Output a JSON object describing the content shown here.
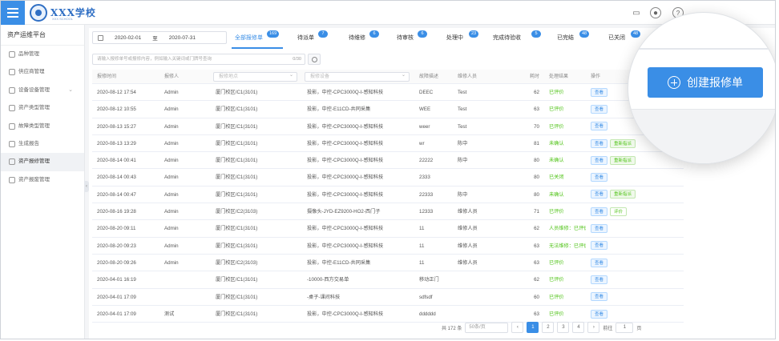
{
  "header": {
    "school_name": "XXX学校",
    "school_sub": "XXX SCHOOL",
    "icons": [
      "message-icon",
      "user-avatar",
      "help-icon"
    ]
  },
  "sidebar": {
    "title": "资产运维平台",
    "items": [
      {
        "label": "品种管理",
        "icon": "tag-icon"
      },
      {
        "label": "供应商管理",
        "icon": "supplier-icon"
      },
      {
        "label": "设备设备管理",
        "icon": "device-icon",
        "has_arrow": true
      },
      {
        "label": "资产类型管理",
        "icon": "asset-icon"
      },
      {
        "label": "故障类型管理",
        "icon": "fault-icon"
      },
      {
        "label": "生成报告",
        "icon": "report-icon"
      },
      {
        "label": "资产报修管理",
        "icon": "repair-icon",
        "active": true
      },
      {
        "label": "资产报废管理",
        "icon": "scrap-icon"
      }
    ]
  },
  "filters": {
    "date_start": "2020-02-01",
    "date_sep": "至",
    "date_end": "2020-07-31",
    "search_placeholder": "请输入报修单号或报修内容，例如输入关键词或门牌号查询",
    "search_count": "0/30"
  },
  "tabs": [
    {
      "label": "全部报修单",
      "badge": "169",
      "active": true
    },
    {
      "label": "待派单",
      "badge": "7"
    },
    {
      "label": "待维修",
      "badge": "6"
    },
    {
      "label": "待审核",
      "badge": "6"
    },
    {
      "label": "处理中",
      "badge": "23"
    },
    {
      "label": "完成待验收",
      "badge": "5"
    },
    {
      "label": "已完结",
      "badge": "48"
    },
    {
      "label": "已关闭",
      "badge": "48"
    }
  ],
  "table": {
    "headers": [
      "报修时间",
      "报修人",
      "报修地点",
      "报修设备",
      "故障描述",
      "维修人员",
      "耗时",
      "处理结果",
      "操作"
    ],
    "rows": [
      {
        "time": "2020-08-12 17:54",
        "reporter": "Admin",
        "place": "厦门校区/C1(3101)",
        "device": "投影，中控-CPC3000Q-I-感知科技",
        "desc": "DEEC",
        "worker": "Test",
        "hours": "62",
        "status": "已评价",
        "actions": [
          "查看"
        ]
      },
      {
        "time": "2020-08-12 10:55",
        "reporter": "Admin",
        "place": "厦门校区/C1(3101)",
        "device": "投影，中控-E11CD-共同采集",
        "desc": "WEE",
        "worker": "Test",
        "hours": "63",
        "status": "已评价",
        "actions": [
          "查看"
        ]
      },
      {
        "time": "2020-08-13 15:27",
        "reporter": "Admin",
        "place": "厦门校区/C1(3101)",
        "device": "投影，中控-CPC3000Q-I-感知科技",
        "desc": "weer",
        "worker": "Test",
        "hours": "70",
        "status": "已评价",
        "actions": [
          "查看"
        ]
      },
      {
        "time": "2020-08-13 13:29",
        "reporter": "Admin",
        "place": "厦门校区/C1(3101)",
        "device": "投影，中控-CPC3000Q-I-感知科技",
        "desc": "wr",
        "worker": "陈中",
        "hours": "81",
        "status": "未确认",
        "actions": [
          "查看",
          "重新指派"
        ]
      },
      {
        "time": "2020-08-14 00:41",
        "reporter": "Admin",
        "place": "厦门校区/C1(3101)",
        "device": "投影，中控-CPC3000Q-I-感知科技",
        "desc": "22222",
        "worker": "陈中",
        "hours": "80",
        "status": "未确认",
        "actions": [
          "查看",
          "重新指派"
        ]
      },
      {
        "time": "2020-08-14 00:43",
        "reporter": "Admin",
        "place": "厦门校区/C1(3101)",
        "device": "投影，中控-CPC3000Q-I-感知科技",
        "desc": "2333",
        "worker": "",
        "hours": "80",
        "status": "已关闭",
        "actions": [
          "查看"
        ]
      },
      {
        "time": "2020-08-14 00:47",
        "reporter": "Admin",
        "place": "厦门校区/C1(3101)",
        "device": "投影，中控-CPC3000Q-I-感知科技",
        "desc": "22333",
        "worker": "陈中",
        "hours": "80",
        "status": "未确认",
        "actions": [
          "查看",
          "重新指派"
        ]
      },
      {
        "time": "2020-08-16 19:28",
        "reporter": "Admin",
        "place": "厦门校区/C2(3103)",
        "device": "摄像头-JYD-EZ9200-HO2-西门子",
        "desc": "12333",
        "worker": "维修人员",
        "hours": "71",
        "status": "已评价",
        "actions": [
          "查看",
          "评价"
        ]
      },
      {
        "time": "2020-08-20 09:11",
        "reporter": "Admin",
        "place": "厦门校区/C1(3101)",
        "device": "投影，中控-CPC3000Q-I-感知科技",
        "desc": "11",
        "worker": "维修人员",
        "hours": "62",
        "status": "人员维修：已评价",
        "actions": [
          "查看"
        ]
      },
      {
        "time": "2020-08-20 09:23",
        "reporter": "Admin",
        "place": "厦门校区/C1(3101)",
        "device": "投影，中控-CPC3000Q-I-感知科技",
        "desc": "11",
        "worker": "维修人员",
        "hours": "63",
        "status": "无法维修：已评价",
        "actions": [
          "查看"
        ]
      },
      {
        "time": "2020-08-20 09:26",
        "reporter": "Admin",
        "place": "厦门校区/C2(3103)",
        "device": "投影，中控-E11CD-共同采集",
        "desc": "11",
        "worker": "维修人员",
        "hours": "63",
        "status": "已评价",
        "actions": [
          "查看"
        ]
      },
      {
        "time": "2020-04-01 16:19",
        "reporter": "",
        "place": "厦门校区/C1(3101)",
        "device": "-10000-西方交易单",
        "desc": "移动正门",
        "worker": "",
        "hours": "62",
        "status": "已评价",
        "actions": [
          "查看"
        ]
      },
      {
        "time": "2020-04-01 17:09",
        "reporter": "",
        "place": "厦门校区/C1(3101)",
        "device": "-桌子-课间科技",
        "desc": "sdfsdf",
        "worker": "",
        "hours": "60",
        "status": "已评价",
        "actions": [
          "查看"
        ]
      },
      {
        "time": "2020-04-01 17:09",
        "reporter": "测试",
        "place": "厦门校区/C1(3101)",
        "device": "投影，中控-CPC3000Q-I-感知科技",
        "desc": "dddddd",
        "worker": "",
        "hours": "63",
        "status": "已评价",
        "actions": [
          "查看"
        ]
      }
    ]
  },
  "pagination": {
    "total": "共 172 条",
    "page_size": "50条/页",
    "pages": [
      "1",
      "2",
      "3",
      "4"
    ],
    "active_page": "1",
    "goto_label": "前往",
    "goto_value": "1",
    "page_suffix": "页"
  },
  "callout": {
    "create_label": "创建报修单"
  },
  "colors": {
    "primary": "#3a8ee6",
    "success": "#52c41a"
  }
}
